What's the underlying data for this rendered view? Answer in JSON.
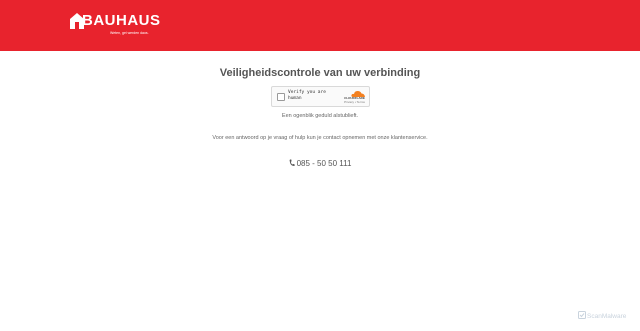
{
  "header": {
    "brand": "BAUHAUS",
    "tagline": "Weten, gei werden daos.",
    "color": "#e8232d"
  },
  "main": {
    "title": "Veiligheidscontrole van uw verbinding",
    "captcha": {
      "checkbox_label": "Verify you are human",
      "provider": "CLOUDFLARE",
      "links": "Privacy • Terms"
    },
    "wait_text": "Een ogenblik geduld alstublieft.",
    "contact_text": "Voor een antwoord op je vraag of hulp kun je contact opnemen met onze klantenservice.",
    "phone": "085 - 50 50 111"
  },
  "watermark": "ScanMalware",
  "icons": [
    "bauhaus-logo-icon",
    "cloudflare-cloud-icon",
    "phone-icon",
    "scanmalware-icon"
  ]
}
